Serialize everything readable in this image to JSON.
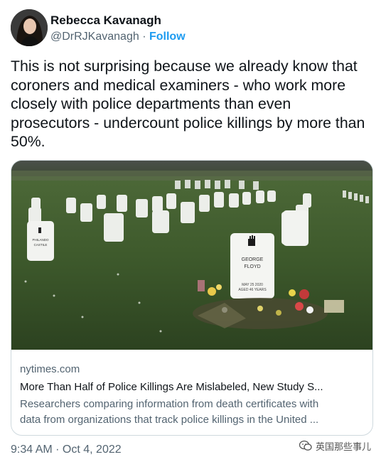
{
  "author": {
    "name": "Rebecca Kavanagh",
    "handle": "@DrRJKavanagh",
    "separator": "·",
    "follow_label": "Follow"
  },
  "tweet": {
    "text": "This is not surprising because we already know that coroners and medical examiners - who work more closely with police departments than even prosecutors - undercount police killings by more than 50%."
  },
  "card": {
    "domain": "nytimes.com",
    "title": "More Than Half of Police Killings Are Mislabeled, New Study S...",
    "description_line1": "Researchers comparing information from death certificates with",
    "description_line2": "data from organizations that track police killings in the United ...",
    "image": {
      "headstone_main_line1": "GEORGE",
      "headstone_main_line2": "FLOYD",
      "headstone_main_date": "MAY 25 2020",
      "headstone_main_age": "AGED 46 YEARS",
      "headstone_left_line1": "PHILANDO",
      "headstone_left_line2": "CASTILE"
    }
  },
  "meta": {
    "timestamp": "9:34 AM · Oct 4, 2022"
  },
  "watermark": {
    "text": "英国那些事儿"
  },
  "colors": {
    "accent": "#1d9bf0",
    "secondary_text": "#536471",
    "border": "#cfd9de"
  }
}
